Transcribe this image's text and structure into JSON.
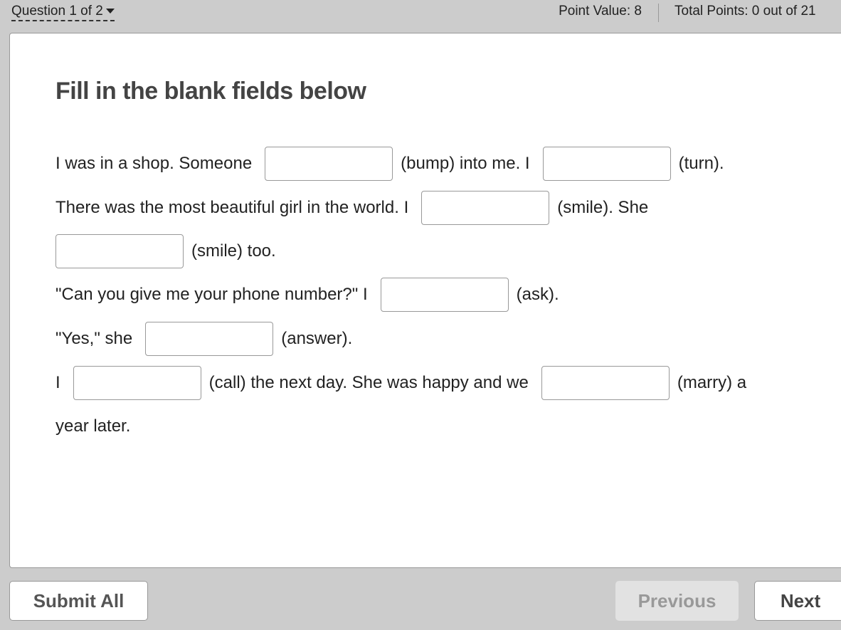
{
  "header": {
    "question_nav": "Question 1 of 2",
    "point_value": "Point Value: 8",
    "total_points": "Total Points: 0 out of 21"
  },
  "title": "Fill in the blank fields below",
  "text": {
    "l1a": "I was in a shop. Someone",
    "l1b": "(bump) into me. I",
    "l1c": "(turn).",
    "l2a": "There was the most beautiful girl in the world. I",
    "l2b": "(smile). She",
    "l3a": "(smile) too.",
    "l4a": "\"Can you give me your phone number?\" I",
    "l4b": "(ask).",
    "l5a": "\"Yes,\" she",
    "l5b": "(answer).",
    "l6a": "I",
    "l6b": "(call) the next day. She was happy and we",
    "l6c": "(marry) a",
    "l7a": "year later."
  },
  "blanks": [
    "",
    "",
    "",
    "",
    "",
    "",
    "",
    ""
  ],
  "buttons": {
    "submit": "Submit All",
    "previous": "Previous",
    "next": "Next"
  }
}
